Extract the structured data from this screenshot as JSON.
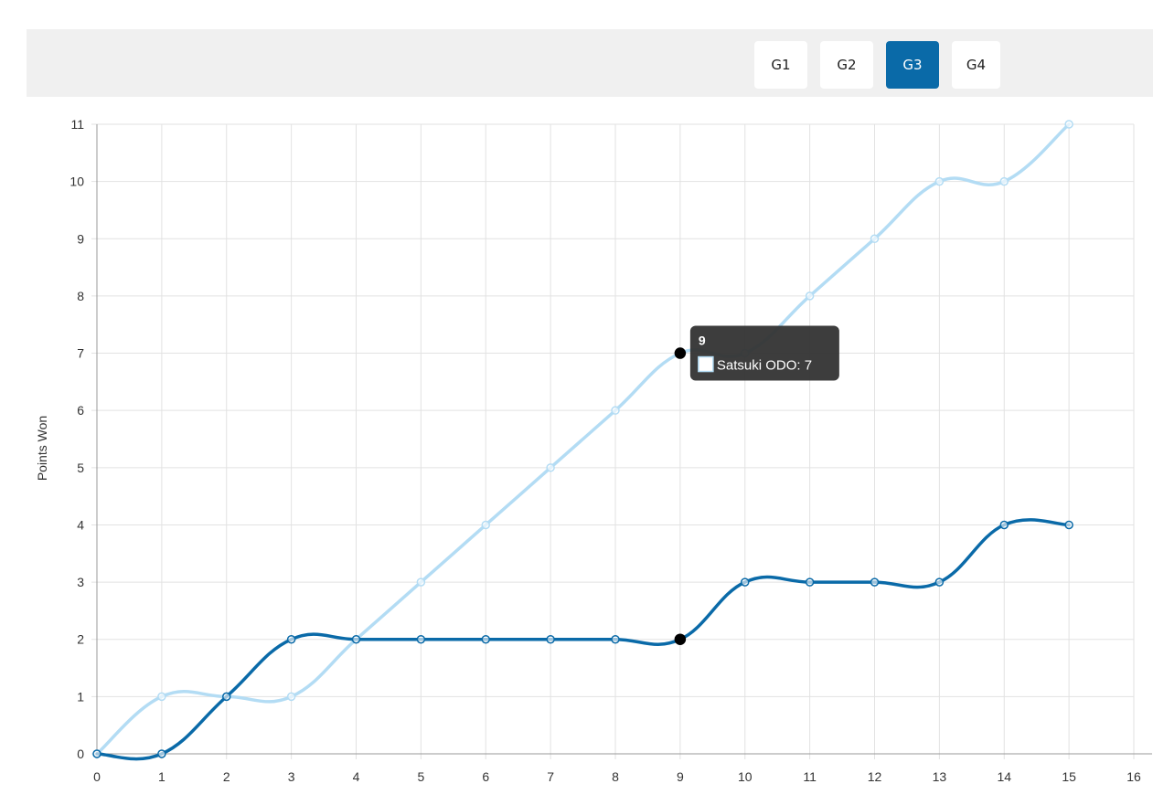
{
  "toolbar": {
    "tabs": [
      {
        "label": "G1",
        "active": false
      },
      {
        "label": "G2",
        "active": false
      },
      {
        "label": "G3",
        "active": true
      },
      {
        "label": "G4",
        "active": false
      }
    ]
  },
  "colors": {
    "accent": "#0a6aa8",
    "series_dark": "#0a6aa8",
    "series_light": "#b3dcf4",
    "grid": "#e2e2e2",
    "tooltip_bg": "#333333"
  },
  "chart_data": {
    "type": "line",
    "ylabel": "Points Won",
    "xlabel": "",
    "xlim": [
      0,
      16
    ],
    "ylim": [
      0,
      11
    ],
    "x_ticks": [
      0,
      1,
      2,
      3,
      4,
      5,
      6,
      7,
      8,
      9,
      10,
      11,
      12,
      13,
      14,
      15,
      16
    ],
    "y_ticks": [
      0,
      1,
      2,
      3,
      4,
      5,
      6,
      7,
      8,
      9,
      10,
      11
    ],
    "grid": true,
    "x": [
      0,
      1,
      2,
      3,
      4,
      5,
      6,
      7,
      8,
      9,
      10,
      11,
      12,
      13,
      14,
      15
    ],
    "series": [
      {
        "name": "Satsuki ODO",
        "color": "#b3dcf4",
        "values": [
          0,
          1,
          1,
          1,
          2,
          3,
          4,
          5,
          6,
          7,
          7,
          8,
          9,
          10,
          10,
          11
        ]
      },
      {
        "color": "#0a6aa8",
        "values": [
          0,
          0,
          1,
          2,
          2,
          2,
          2,
          2,
          2,
          2,
          3,
          3,
          3,
          3,
          4,
          4
        ]
      }
    ],
    "hover_index": 9,
    "tooltip": {
      "title": "9",
      "label": "Satsuki ODO: 7"
    }
  }
}
